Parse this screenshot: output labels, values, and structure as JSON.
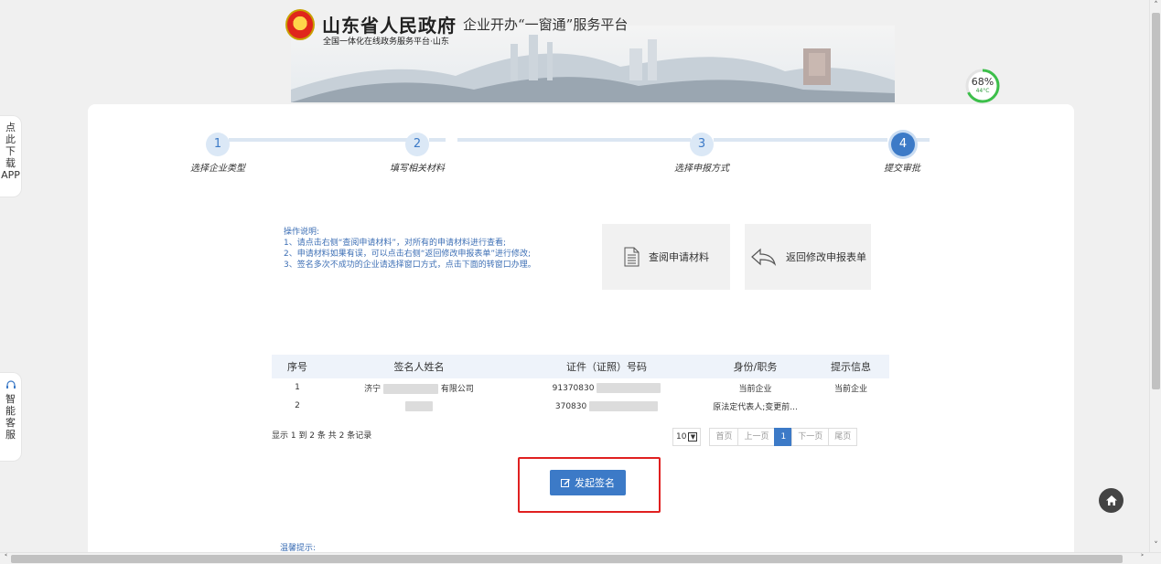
{
  "header": {
    "gov_name": "山东省人民政府",
    "gov_sub": "全国一体化在线政务服务平台·山东",
    "platform_title": "企业开办“一窗通”服务平台"
  },
  "gauge": {
    "percent_label": "68%",
    "temp": "44°C",
    "value": 68
  },
  "side_tabs": {
    "download": [
      "点",
      "此",
      "下",
      "载",
      "APP"
    ],
    "service": [
      "智",
      "能",
      "客",
      "服"
    ]
  },
  "steps": [
    {
      "num": "1",
      "label": "选择企业类型"
    },
    {
      "num": "2",
      "label": "填写相关材料"
    },
    {
      "num": "3",
      "label": "选择申报方式"
    },
    {
      "num": "4",
      "label": "提交审批"
    }
  ],
  "instructions": {
    "title": "操作说明:",
    "lines": [
      "1、请点击右侧“查阅申请材料”，对所有的申请材料进行查看;",
      "2、申请材料如果有误，可以点击右侧“返回修改申报表单”进行修改;",
      "3、签名多次不成功的企业请选择窗口方式，点击下面的转窗口办理。"
    ]
  },
  "buttons": {
    "view_materials": "查阅申请材料",
    "back_modify": "返回修改申报表单",
    "start_sign": "发起签名"
  },
  "table": {
    "headers": [
      "序号",
      "签名人姓名",
      "证件（证照）号码",
      "身份/职务",
      "提示信息"
    ],
    "rows": [
      {
        "no": "1",
        "name_prefix": "济宁",
        "name_suffix": "有限公司",
        "id_prefix": "91370830",
        "role": "当前企业",
        "tip": "当前企业"
      },
      {
        "no": "2",
        "name_prefix": "",
        "name_suffix": "",
        "id_prefix": "370830",
        "role": "原法定代表人;变更前...",
        "tip": ""
      }
    ]
  },
  "records_text": "显示 1 到 2 条 共 2 条记录",
  "pager": {
    "page_size": "10",
    "first": "首页",
    "prev": "上一页",
    "current": "1",
    "next": "下一页",
    "last": "尾页"
  },
  "tips_title": "温馨提示:"
}
